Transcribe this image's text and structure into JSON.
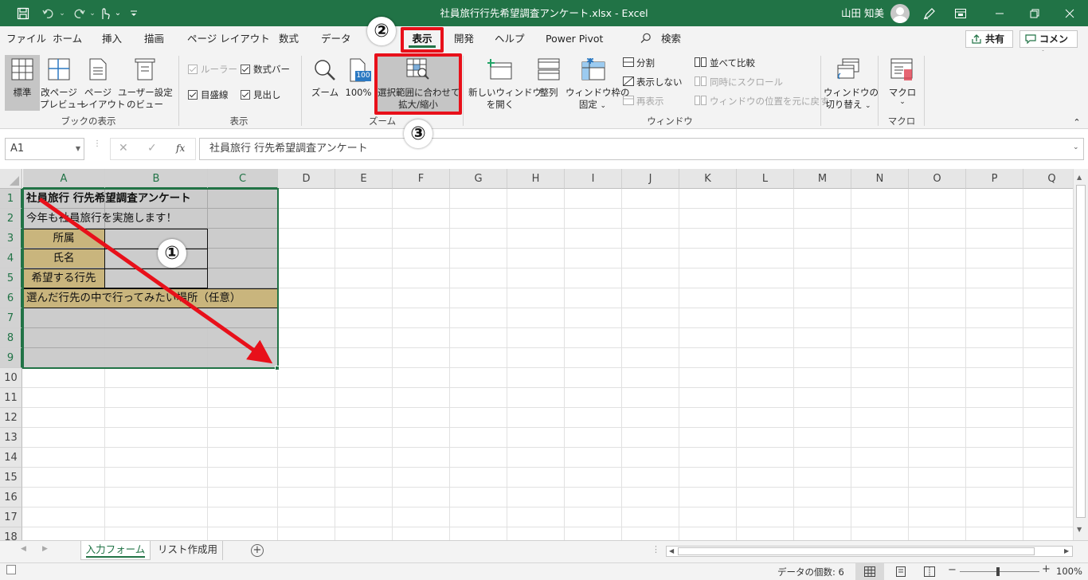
{
  "title_bar": {
    "document_title": "社員旅行行先希望調査アンケート.xlsx  -  Excel",
    "user_name": "山田 知美",
    "quick_access": [
      "save-icon",
      "undo-icon",
      "redo-icon",
      "touch-mode-icon",
      "customize-icon"
    ],
    "window_buttons": [
      "ribbon-display-icon",
      "minimize-icon",
      "restore-icon",
      "close-icon"
    ]
  },
  "menu": {
    "tabs": [
      "ファイル",
      "ホーム",
      "挿入",
      "描画",
      "ページ レイアウト",
      "数式",
      "データ",
      "表示",
      "開発",
      "ヘルプ",
      "Power Pivot"
    ],
    "active_tab": "表示",
    "search_label": "検索",
    "share_label": "共有",
    "comment_label": "コメント"
  },
  "ribbon": {
    "book_view": {
      "label": "ブックの表示",
      "buttons": [
        {
          "line1": "標準",
          "line2": ""
        },
        {
          "line1": "改ページ",
          "line2": "プレビュー"
        },
        {
          "line1": "ページ",
          "line2": "レイアウト"
        },
        {
          "line1": "ユーザー設定",
          "line2": "のビュー"
        }
      ]
    },
    "show": {
      "label": "表示",
      "ruler": "ルーラー",
      "formula_bar": "数式バー",
      "gridlines": "目盛線",
      "headings": "見出し"
    },
    "zoom": {
      "label": "ズーム",
      "zoom_btn": "ズーム",
      "hundred_btn": "100%",
      "hundred_icon_text": "100",
      "selection_line1": "選択範囲に合わせて",
      "selection_line2": "拡大/縮小"
    },
    "window": {
      "label": "ウィンドウ",
      "new_window_line1": "新しいウィンドウ",
      "new_window_line2": "を開く",
      "arrange": "整列",
      "freeze_line1": "ウィンドウ枠の",
      "freeze_line2": "固定",
      "split": "分割",
      "hide": "表示しない",
      "unhide": "再表示",
      "side_by_side": "並べて比較",
      "sync_scroll": "同時にスクロール",
      "reset_position": "ウィンドウの位置を元に戻す",
      "switch_line1": "ウィンドウの",
      "switch_line2": "切り替え"
    },
    "macros": {
      "label": "マクロ",
      "button": "マクロ"
    }
  },
  "formula_bar": {
    "name_box": "A1",
    "fx": "fx",
    "content": "社員旅行 行先希望調査アンケート"
  },
  "grid": {
    "columns": [
      "A",
      "B",
      "C",
      "D",
      "E",
      "F",
      "G",
      "H",
      "I",
      "J",
      "K",
      "L",
      "M",
      "N",
      "O",
      "P",
      "Q"
    ],
    "rows": [
      "1",
      "2",
      "3",
      "4",
      "5",
      "6",
      "7",
      "8",
      "9",
      "10",
      "11",
      "12",
      "13",
      "14",
      "15",
      "16",
      "17",
      "18"
    ],
    "cells": {
      "A1": "社員旅行 行先希望調査アンケート",
      "A2": "今年も社員旅行を実施します！",
      "A3": "所属",
      "A4": "氏名",
      "A5": "希望する行先",
      "A6": "選んだ行先の中で行ってみたい場所（任意）"
    },
    "selection": "A1:C9"
  },
  "sheets": {
    "tabs": [
      "入力フォーム",
      "リスト作成用"
    ],
    "active": "入力フォーム"
  },
  "status_bar": {
    "count_label": "データの個数: 6",
    "zoom": "100%"
  },
  "annotations": {
    "step1": "①",
    "step2": "②",
    "step3": "③"
  },
  "colors": {
    "excel_green": "#217346",
    "highlight_red": "#e8101a",
    "label_fill": "#c9b57d",
    "selection_tint": "#c8c8c8"
  }
}
